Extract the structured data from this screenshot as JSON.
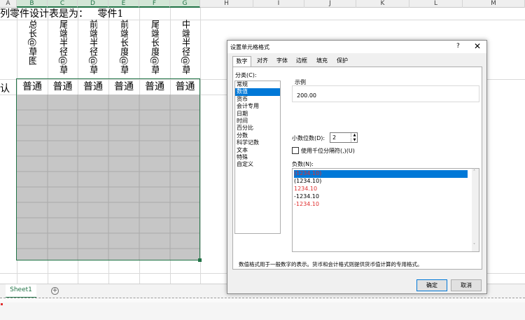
{
  "spreadsheet": {
    "columns": [
      "A",
      "B",
      "C",
      "D",
      "E",
      "F",
      "G",
      "H",
      "I",
      "J",
      "K",
      "L",
      "M"
    ],
    "title_text": "列零件设计表是为：   零件1",
    "vertical_headers": [
      "总长@草图",
      "尾端半径@草",
      "前端半径@草",
      "前端长度@草",
      "尾端长度@草",
      "中端半径@草"
    ],
    "row_label": "认",
    "row_values": [
      "普通",
      "普通",
      "普通",
      "普通",
      "普通",
      "普通"
    ],
    "sheet_tab": "Sheet1",
    "add_sheet": "+",
    "accent_color": "#217346"
  },
  "dialog": {
    "title": "设置单元格格式",
    "help": "?",
    "close": "✕",
    "tabs": [
      "数字",
      "对齐",
      "字体",
      "边框",
      "填充",
      "保护"
    ],
    "active_tab": "数字",
    "category_label": "分类(C):",
    "categories": [
      "常规",
      "数值",
      "货币",
      "会计专用",
      "日期",
      "时间",
      "百分比",
      "分数",
      "科学记数",
      "文本",
      "特殊",
      "自定义"
    ],
    "selected_category": "数值",
    "example_label": "示例",
    "example_value": "200.00",
    "decimal_label": "小数位数(D):",
    "decimal_value": "2",
    "thousands_label": "使用千位分隔符(,)(U)",
    "negative_label": "负数(N):",
    "negative_options": [
      {
        "text": "(1234.10)",
        "color": "#e03030",
        "selected": true
      },
      {
        "text": "(1234.10)",
        "color": "#000000",
        "selected": false
      },
      {
        "text": "1234.10",
        "color": "#e03030",
        "selected": false
      },
      {
        "text": "-1234.10",
        "color": "#000000",
        "selected": false
      },
      {
        "text": "-1234.10",
        "color": "#e03030",
        "selected": false
      }
    ],
    "description": "数值格式用于一般数字的表示。货币和会计格式则提供货币值计算的专用格式。",
    "ok": "确定",
    "cancel": "取消",
    "selection_color": "#0078d7"
  }
}
